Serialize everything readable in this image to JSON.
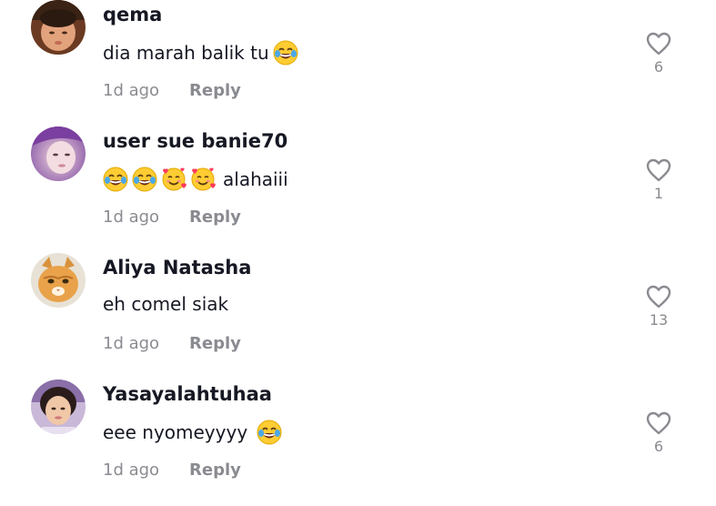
{
  "comments": [
    {
      "username": "qema",
      "text": "dia marah balik tu",
      "time": "1d ago",
      "reply_label": "Reply",
      "likes": "6",
      "avatar_icon": "child-photo-avatar",
      "emoji_after": [
        "face-with-tears-of-joy"
      ]
    },
    {
      "username": "user sue banie70",
      "text": "alahaiii",
      "time": "1d ago",
      "reply_label": "Reply",
      "likes": "1",
      "avatar_icon": "woman-photo-avatar",
      "emoji_before": [
        "face-with-tears-of-joy",
        "face-with-tears-of-joy",
        "smiling-face-with-hearts",
        "smiling-face-with-hearts"
      ]
    },
    {
      "username": "Aliya Natasha",
      "text": "eh comel siak",
      "time": "1d ago",
      "reply_label": "Reply",
      "likes": "13",
      "avatar_icon": "cat-photo-avatar"
    },
    {
      "username": "Yasayalahtuhaa",
      "text": "eee nyomeyyyy",
      "time": "1d ago",
      "reply_label": "Reply",
      "likes": "6",
      "avatar_icon": "girl-photo-avatar",
      "emoji_after": [
        "face-with-tears-of-joy"
      ]
    }
  ],
  "colors": {
    "text": "#161823",
    "muted": "#8a8b91",
    "emoji_face": "#ffcc33"
  }
}
